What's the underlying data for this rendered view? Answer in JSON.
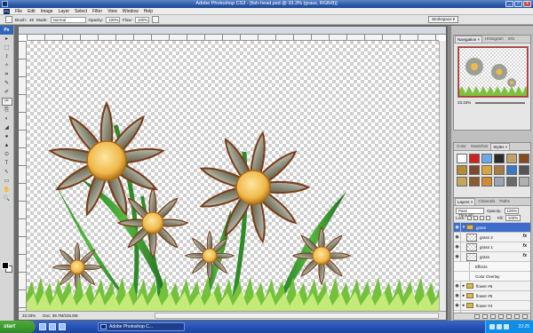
{
  "window": {
    "title": "Adobe Photoshop CS3 - [fish-head.psd @ 33.3% (grass, RGB/8)]",
    "logo": "Ps",
    "buttons": [
      "_",
      "□",
      "x"
    ]
  },
  "menu": {
    "badge": "Ps",
    "items": [
      "File",
      "Edit",
      "Image",
      "Layer",
      "Select",
      "Filter",
      "View",
      "Window",
      "Help"
    ]
  },
  "options": {
    "brush_label": "Brush:",
    "brush_size": "46",
    "mode_label": "Mode:",
    "mode_value": "Normal",
    "opacity_label": "Opacity:",
    "opacity_value": "100%",
    "flow_label": "Flow:",
    "flow_value": "100%",
    "workspace": "Workspace ▾"
  },
  "toolbox": {
    "header": "Ps",
    "tools": [
      "▸",
      "⬚",
      "ℓ",
      "✧",
      "⌗",
      "✎",
      "✐",
      "✑",
      "⎘",
      "◐",
      "◢",
      "●",
      "▲",
      "⊙",
      "T",
      "↖",
      "▭",
      "✋",
      "🔍"
    ]
  },
  "document": {
    "zoom": "33.33%",
    "doc_size": "Doc: 39.7M/226.6M"
  },
  "navigator": {
    "tabs": [
      "Navigation ×",
      "Histogram",
      "Info"
    ],
    "zoom": "33.33%"
  },
  "styles": {
    "tabs": [
      "Color",
      "Swatches",
      "Styles ×"
    ],
    "swatches": [
      "#ffffff",
      "#d12020",
      "#6aa8e8",
      "#2a2a2a",
      "#c2a16b",
      "#8a4a20",
      "#b58a30",
      "#7a4a2a",
      "#d6a640",
      "#aa7a44",
      "#3d78c8",
      "#555555",
      "#c7a55a",
      "#8e5a2a",
      "#d58a30",
      "#9aa6b0",
      "#6a6a6a",
      "#b0b0b0"
    ]
  },
  "layers": {
    "tabs": [
      "Layers ×",
      "Channels",
      "Paths"
    ],
    "blend_mode": "Pass Through",
    "opacity_label": "Opacity:",
    "opacity_value": "100%",
    "lock_label": "Lock:",
    "fill_label": "Fill:",
    "fill_value": "100%",
    "rows": [
      {
        "name": "grass",
        "type": "group",
        "selected": true,
        "fx": ""
      },
      {
        "name": "grass 2",
        "type": "layer",
        "selected": false,
        "fx": "fx"
      },
      {
        "name": "grass 1",
        "type": "layer",
        "selected": false,
        "fx": "fx"
      },
      {
        "name": "grass",
        "type": "layer",
        "selected": false,
        "fx": "fx"
      },
      {
        "name": "Effects",
        "type": "effect",
        "selected": false,
        "fx": ""
      },
      {
        "name": "Color Overlay",
        "type": "effect",
        "selected": false,
        "fx": ""
      },
      {
        "name": "flower #6",
        "type": "group",
        "selected": false,
        "fx": ""
      },
      {
        "name": "flower #5",
        "type": "group",
        "selected": false,
        "fx": ""
      },
      {
        "name": "flower #4",
        "type": "group",
        "selected": false,
        "fx": ""
      },
      {
        "name": "flower #3",
        "type": "group",
        "selected": false,
        "fx": ""
      }
    ]
  },
  "taskbar": {
    "start": "start",
    "task": "Adobe Photoshop C...",
    "clock": "22:25"
  }
}
